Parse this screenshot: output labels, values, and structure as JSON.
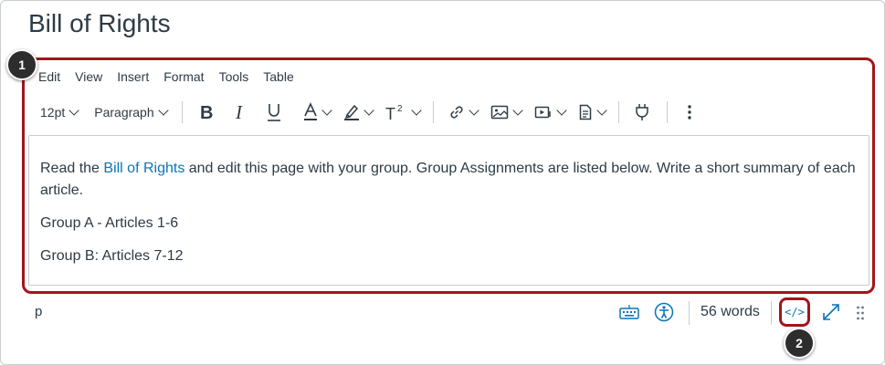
{
  "page": {
    "title": "Bill of Rights"
  },
  "menubar": {
    "items": [
      "Edit",
      "View",
      "Insert",
      "Format",
      "Tools",
      "Table"
    ]
  },
  "toolbar": {
    "font_size": "12pt",
    "block_format": "Paragraph",
    "icons": [
      "bold-icon",
      "italic-icon",
      "underline-icon",
      "text-color-icon",
      "highlight-color-icon",
      "superscript-icon",
      "link-icon",
      "image-icon",
      "media-icon",
      "document-icon",
      "plugin-icon",
      "more-icon"
    ]
  },
  "editor": {
    "para1_before": "Read the ",
    "para1_link": "Bill of Rights",
    "para1_after": " and edit this page with your group. Group Assignments are listed below. Write a short summary of each",
    "para1_line2": "article.",
    "para2": "Group A - Articles 1-6",
    "para3": "Group B: Articles 7-12"
  },
  "statusbar": {
    "path": "p",
    "word_count": "56 words",
    "html_toggle": "</>"
  },
  "callouts": {
    "badge1": "1",
    "badge2": "2"
  },
  "colors": {
    "accent": "#0b74b9",
    "highlight": "#a0161c",
    "text": "#2d3b45",
    "border": "#c7cdd1"
  }
}
